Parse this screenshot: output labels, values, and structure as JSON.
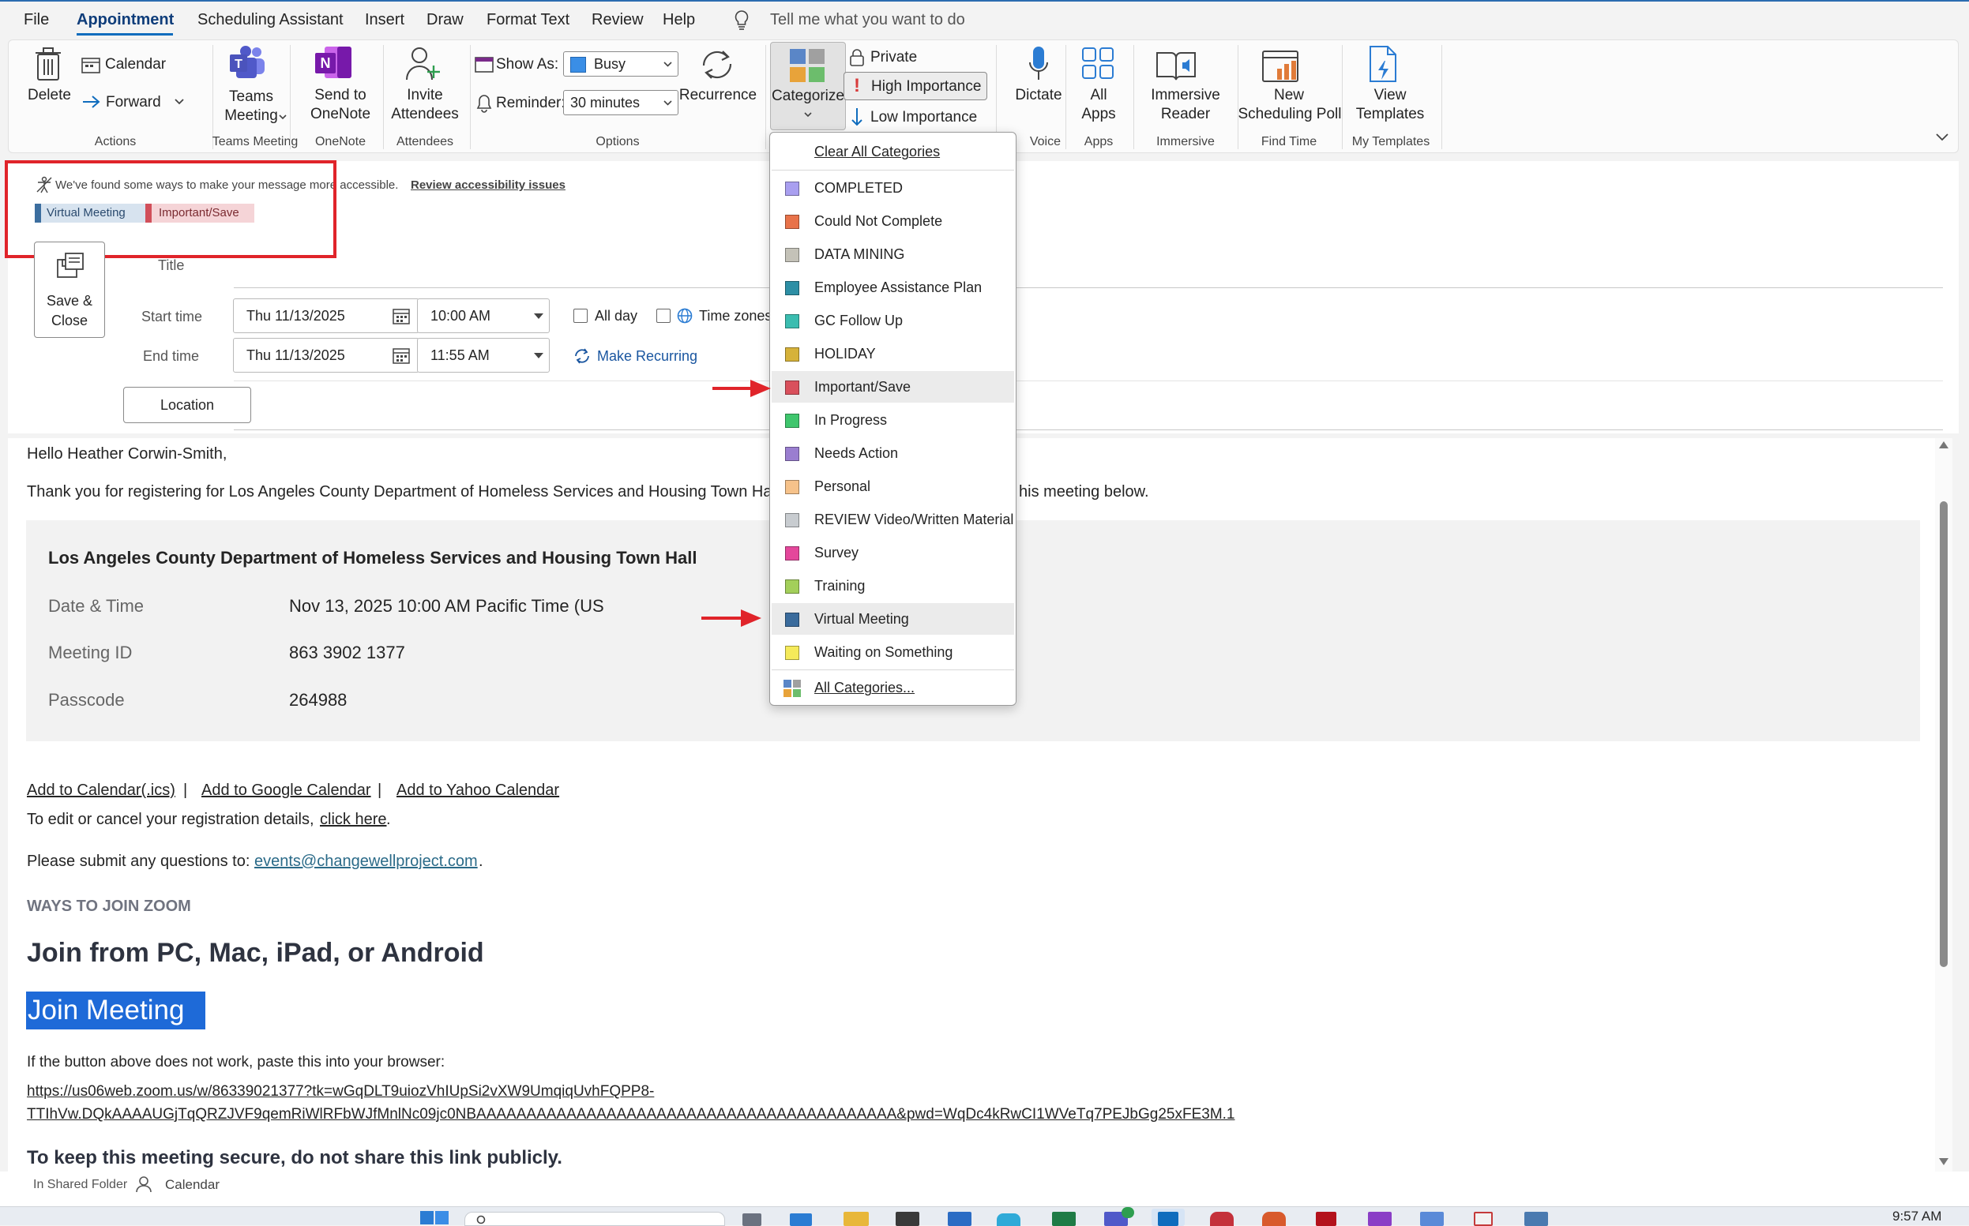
{
  "menu": {
    "items": [
      "File",
      "Appointment",
      "Scheduling Assistant",
      "Insert",
      "Draw",
      "Format Text",
      "Review",
      "Help"
    ],
    "tell_me": "Tell me what you want to do"
  },
  "ribbon": {
    "delete": "Delete",
    "calendar": "Calendar",
    "forward": "Forward",
    "group_actions": "Actions",
    "teams_meeting": "Teams Meeting",
    "teams_meeting_line1": "Teams",
    "teams_meeting_line2": "Meeting",
    "group_teams": "Teams Meeting",
    "send_onenote_line1": "Send to",
    "send_onenote_line2": "OneNote",
    "group_onenote": "OneNote",
    "invite_line1": "Invite",
    "invite_line2": "Attendees",
    "group_attendees": "Attendees",
    "show_as_label": "Show As:",
    "show_as_value": "Busy",
    "reminder_label": "Reminder:",
    "reminder_value": "30 minutes",
    "recurrence": "Recurrence",
    "group_options": "Options",
    "categorize": "Categorize",
    "private": "Private",
    "high_importance": "High Importance",
    "low_importance": "Low Importance",
    "dictate": "Dictate",
    "group_voice": "Voice",
    "all_apps_line1": "All",
    "all_apps_line2": "Apps",
    "group_apps": "Apps",
    "immersive_line1": "Immersive",
    "immersive_line2": "Reader",
    "group_immersive": "Immersive",
    "poll_line1": "New",
    "poll_line2": "Scheduling Poll",
    "group_findtime": "Find Time",
    "templates_line1": "View",
    "templates_line2": "Templates",
    "group_templates": "My Templates"
  },
  "form": {
    "accessibility_msg": "We've found some ways to make your message more accessible.",
    "accessibility_link": "Review accessibility issues",
    "tags": [
      {
        "label": "Virtual Meeting",
        "color": "#3c6e9f",
        "bg": "#d7e3ef"
      },
      {
        "label": "Important/Save",
        "color": "#d14f5a",
        "bg": "#f5d4d7"
      }
    ],
    "save_close_line1": "Save &",
    "save_close_line2": "Close",
    "title_label": "Title",
    "start_label": "Start time",
    "start_date": "Thu 11/13/2025",
    "start_time": "10:00 AM",
    "all_day": "All day",
    "time_zones": "Time zones",
    "end_label": "End time",
    "end_date": "Thu 11/13/2025",
    "end_time": "11:55 AM",
    "make_recurring": "Make Recurring",
    "location": "Location"
  },
  "body": {
    "greeting": "Hello Heather Corwin-Smith,",
    "thanks_a": "Thank you for registering for Los Angeles County Department of Homeless Services and Housing Town Ha",
    "thanks_b": "his meeting below.",
    "card_title": "Los Angeles County Department of Homeless Services and Housing Town Hall",
    "rows": [
      {
        "label": "Date & Time",
        "value": "Nov 13, 2025 10:00 AM Pacific Time (US"
      },
      {
        "label": "Meeting ID",
        "value": "863 3902 1377"
      },
      {
        "label": "Passcode",
        "value": "264988"
      }
    ],
    "add_ics": "Add to Calendar(.ics)",
    "add_google": "Add to Google Calendar",
    "add_yahoo": "Add to Yahoo Calendar",
    "separator": "|",
    "edit_text": "To edit or cancel your registration details,",
    "edit_link": "click here",
    "questions_text": "Please submit any questions to:",
    "questions_email": "events@changewellproject.com",
    "ways_heading": "WAYS TO JOIN ZOOM",
    "join_heading": "Join from PC, Mac, iPad, or Android",
    "join_button": "Join Meeting",
    "fallback_text": "If the button above does not work, paste this into your browser:",
    "url_line1": "https://us06web.zoom.us/w/86339021377?tk=wGqDLT9uiozVhIUpSi2vXW9UmqiqUvhFQPP8-",
    "url_line2": "TTIhVw.DQkAAAAUGjTqQRZJVF9qemRiWlRFbWJfMnlNc09jc0NBAAAAAAAAAAAAAAAAAAAAAAAAAAAAAAAAAAAAAAAAAA&pwd=WqDc4kRwCI1WVeTq7PEJbGg25xFE3M.1",
    "secure_text": "To keep this meeting secure, do not share this link publicly."
  },
  "categorize_menu": {
    "clear_all": "Clear All Categories",
    "items": [
      {
        "label": "COMPLETED",
        "color": "#a99ff0"
      },
      {
        "label": "Could Not Complete",
        "color": "#e8734a"
      },
      {
        "label": "DATA MINING",
        "color": "#c4c2b8"
      },
      {
        "label": "Employee Assistance Plan",
        "color": "#2d8fa5"
      },
      {
        "label": "GC Follow Up",
        "color": "#3bbdb0"
      },
      {
        "label": "HOLIDAY",
        "color": "#d6b23a"
      },
      {
        "label": "Important/Save",
        "color": "#d9505c"
      },
      {
        "label": "In Progress",
        "color": "#3fc66d"
      },
      {
        "label": "Needs Action",
        "color": "#9a7ed0"
      },
      {
        "label": "Personal",
        "color": "#f6c28a"
      },
      {
        "label": "REVIEW Video/Written Material",
        "color": "#c8ccd0"
      },
      {
        "label": "Survey",
        "color": "#e4479b"
      },
      {
        "label": "Training",
        "color": "#a3cf5a"
      },
      {
        "label": "Virtual Meeting",
        "color": "#3a6b9c"
      },
      {
        "label": "Waiting on Something",
        "color": "#f5ea5a"
      }
    ],
    "all_categories": "All Categories..."
  },
  "status": {
    "folder": "In Shared Folder",
    "calendar": "Calendar",
    "clock": "9:57 AM"
  },
  "colors": {
    "accent": "#0f6cbd",
    "annotation_red": "#e0242a"
  }
}
